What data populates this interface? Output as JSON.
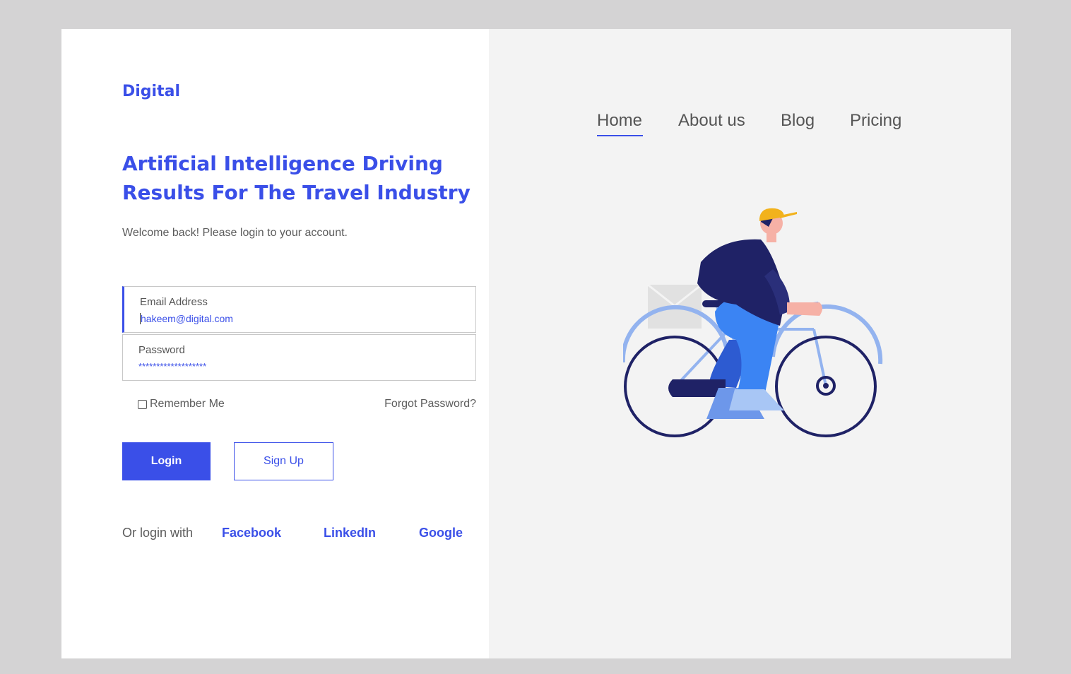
{
  "brand": "Digital",
  "headline_line1": "Artificial Intelligence Driving",
  "headline_line2": "Results For The Travel Industry",
  "subtitle": "Welcome back! Please login to your account.",
  "form": {
    "email_label": "Email Address",
    "email_value": "hakeem@digital.com",
    "password_label": "Password",
    "password_value": "*******************",
    "remember_label": "Remember Me",
    "remember_checked": false,
    "forgot_label": "Forgot Password?",
    "login_label": "Login",
    "signup_label": "Sign Up"
  },
  "social": {
    "label": "Or login with",
    "facebook": "Facebook",
    "linkedin": "LinkedIn",
    "google": "Google"
  },
  "nav": {
    "items": [
      "Home",
      "About us",
      "Blog",
      "Pricing"
    ],
    "active": "Home"
  },
  "colors": {
    "accent": "#3a4fe8",
    "panel_bg": "#f3f3f3",
    "page_bg": "#d4d3d4"
  },
  "illustration": "cyclist-icon"
}
